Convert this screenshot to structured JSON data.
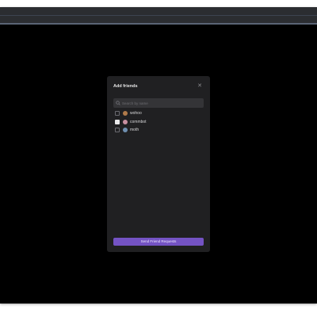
{
  "modal": {
    "title": "Add friends",
    "close_icon": "close-icon",
    "search": {
      "placeholder": "Search by name",
      "value": "",
      "icon": "search-icon"
    },
    "friends": [
      {
        "name": "wohoo",
        "checked": false,
        "avatar_color": "#b07a4a"
      },
      {
        "name": "commbot",
        "checked": true,
        "avatar_color": "#c78fa0"
      },
      {
        "name": "moth",
        "checked": false,
        "avatar_color": "#6f8fb0"
      }
    ],
    "send_label": "Send Friend Requests"
  },
  "colors": {
    "accent": "#7453c4",
    "background": "#000000",
    "modal_bg": "#202022"
  }
}
